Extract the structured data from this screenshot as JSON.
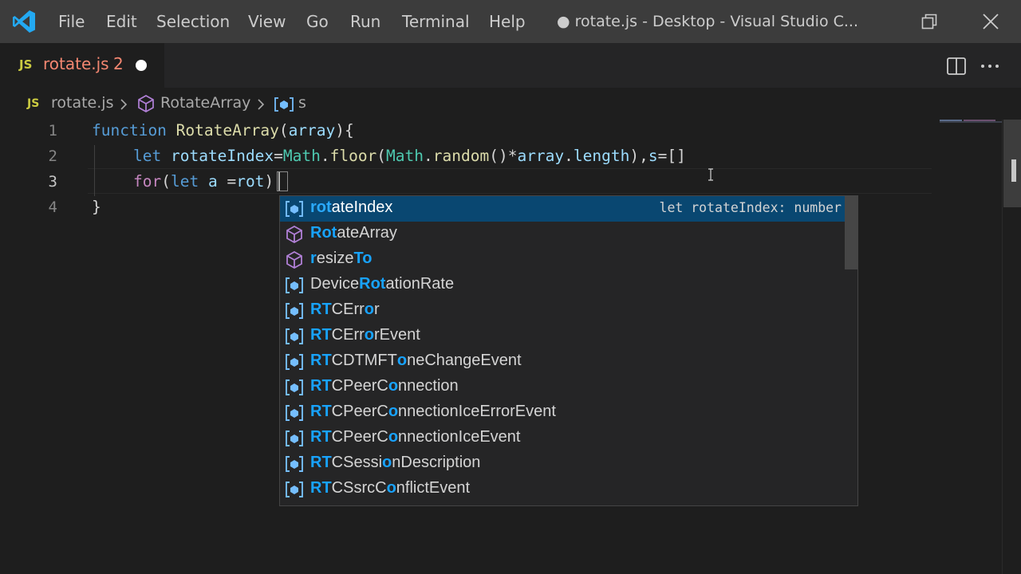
{
  "titlebar": {
    "menu": [
      "File",
      "Edit",
      "Selection",
      "View",
      "Go",
      "Run",
      "Terminal",
      "Help"
    ],
    "title": "● rotate.js - Desktop - Visual Studio C..."
  },
  "tab": {
    "icon_text": "JS",
    "filename": "rotate.js",
    "problems": "2"
  },
  "breadcrumb": {
    "icon_text": "JS",
    "file": "rotate.js",
    "function": "RotateArray",
    "variable": "s"
  },
  "editor": {
    "line_numbers": [
      "1",
      "2",
      "3",
      "4"
    ],
    "line1": {
      "kw": "function",
      "fn": "RotateArray",
      "open": "(",
      "param": "array",
      "close": "){"
    },
    "line2": {
      "kw": "let",
      "v1": "rotateIndex",
      "eq": "=",
      "cls": "Math",
      "dot1": ".",
      "fn1": "floor",
      "p1": "(",
      "cls2": "Math",
      "dot2": ".",
      "fn2": "random",
      "p2": "()*",
      "v2": "array",
      "dot3": ".",
      "v3": "length",
      "p3": "),",
      "v4": "s",
      "p4": "=[]"
    },
    "line3": {
      "kw": "for",
      "p1": "(",
      "kw2": "let",
      "v1": "a",
      "eq": " =",
      "v2": "rot",
      "p2": ")"
    },
    "line4": {
      "p": "}"
    }
  },
  "suggestions": [
    {
      "icon": "variable-icon",
      "pre": "",
      "hl1": "rot",
      "mid": "ateIndex",
      "hl2": "",
      "post": "",
      "detail": "let rotateIndex: number",
      "selected": true
    },
    {
      "icon": "method-icon",
      "pre": "",
      "hl1": "Rot",
      "mid": "ateArray",
      "hl2": "",
      "post": "",
      "detail": ""
    },
    {
      "icon": "method-icon",
      "pre": "",
      "hl1": "r",
      "mid": "esize",
      "hl2": "To",
      "post": "",
      "detail": ""
    },
    {
      "icon": "variable-icon",
      "pre": "Device",
      "hl1": "Rot",
      "mid": "ationRate",
      "hl2": "",
      "post": "",
      "detail": ""
    },
    {
      "icon": "variable-icon",
      "pre": "",
      "hl1": "RT",
      "mid": "CErr",
      "hl2": "o",
      "post": "r",
      "detail": ""
    },
    {
      "icon": "variable-icon",
      "pre": "",
      "hl1": "RT",
      "mid": "CErr",
      "hl2": "o",
      "post": "rEvent",
      "detail": ""
    },
    {
      "icon": "variable-icon",
      "pre": "",
      "hl1": "RT",
      "mid": "CDTMFT",
      "hl2": "o",
      "post": "neChangeEvent",
      "detail": ""
    },
    {
      "icon": "variable-icon",
      "pre": "",
      "hl1": "RT",
      "mid": "CPeerC",
      "hl2": "o",
      "post": "nnection",
      "detail": ""
    },
    {
      "icon": "variable-icon",
      "pre": "",
      "hl1": "RT",
      "mid": "CPeerC",
      "hl2": "o",
      "post": "nnectionIceErrorEvent",
      "detail": ""
    },
    {
      "icon": "variable-icon",
      "pre": "",
      "hl1": "RT",
      "mid": "CPeerC",
      "hl2": "o",
      "post": "nnectionIceEvent",
      "detail": ""
    },
    {
      "icon": "variable-icon",
      "pre": "",
      "hl1": "RT",
      "mid": "CSessi",
      "hl2": "o",
      "post": "nDescription",
      "detail": ""
    },
    {
      "icon": "variable-icon",
      "pre": "",
      "hl1": "RT",
      "mid": "CSsrcC",
      "hl2": "o",
      "post": "nflictEvent",
      "detail": ""
    }
  ],
  "colors": {
    "accent": "#007acc",
    "selection": "#094771",
    "match_highlight": "#18a3ff",
    "method_icon": "#b180d7",
    "error_text": "#f48771"
  }
}
